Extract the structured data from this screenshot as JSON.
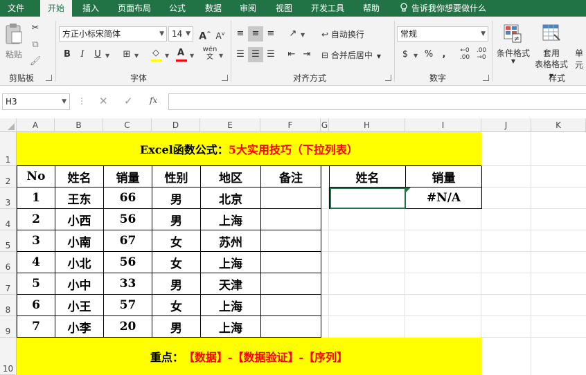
{
  "tabs": [
    "文件",
    "开始",
    "插入",
    "页面布局",
    "公式",
    "数据",
    "审阅",
    "视图",
    "开发工具",
    "帮助"
  ],
  "tell_me": "告诉我你想要做什么",
  "ribbon": {
    "paste_label": "粘贴",
    "clipboard_label": "剪贴板",
    "font_name": "方正小标宋简体",
    "font_size": "14",
    "grow_font": "A",
    "shrink_font": "A",
    "bold": "B",
    "italic": "I",
    "underline": "U",
    "font_group": "字体",
    "wrap_text": "自动换行",
    "merge_center": "合并后居中",
    "align_group": "对齐方式",
    "number_format": "常规",
    "percent": "%",
    "comma": ",",
    "number_group": "数字",
    "cond_format": "条件格式",
    "table_format_1": "套用",
    "table_format_2": "表格格式",
    "cell_style": "单元",
    "styles_group": "样式",
    "font_color_hex": "#ff0000",
    "highlight_hex": "#ffff00"
  },
  "formula_bar": {
    "name_box": "H3",
    "fx": "fx",
    "formula": ""
  },
  "columns": [
    "A",
    "B",
    "C",
    "D",
    "E",
    "F",
    "G",
    "H",
    "I",
    "J",
    "K"
  ],
  "rows": [
    "1",
    "2",
    "3",
    "4",
    "5",
    "6",
    "7",
    "8",
    "9",
    "10"
  ],
  "sheet": {
    "title_black": "Excel函数公式：",
    "title_red": "5大实用技巧（下拉列表）",
    "headers": [
      "No",
      "姓名",
      "销量",
      "性别",
      "地区",
      "备注"
    ],
    "data": [
      [
        "1",
        "王东",
        "66",
        "男",
        "北京",
        ""
      ],
      [
        "2",
        "小西",
        "56",
        "男",
        "上海",
        ""
      ],
      [
        "3",
        "小南",
        "67",
        "女",
        "苏州",
        ""
      ],
      [
        "4",
        "小北",
        "56",
        "女",
        "上海",
        ""
      ],
      [
        "5",
        "小中",
        "33",
        "男",
        "天津",
        ""
      ],
      [
        "6",
        "小王",
        "57",
        "女",
        "上海",
        ""
      ],
      [
        "7",
        "小李",
        "20",
        "男",
        "上海",
        ""
      ]
    ],
    "lookup_headers": [
      "姓名",
      "销量"
    ],
    "lookup_values": [
      "",
      "#N/A"
    ],
    "footer_black": "重点：",
    "footer_red": "【数据】-【数据验证】-【序列】",
    "highlight_hex": "#ffff00",
    "accent_hex": "#ff0000",
    "ribbon_green_hex": "#217346"
  }
}
